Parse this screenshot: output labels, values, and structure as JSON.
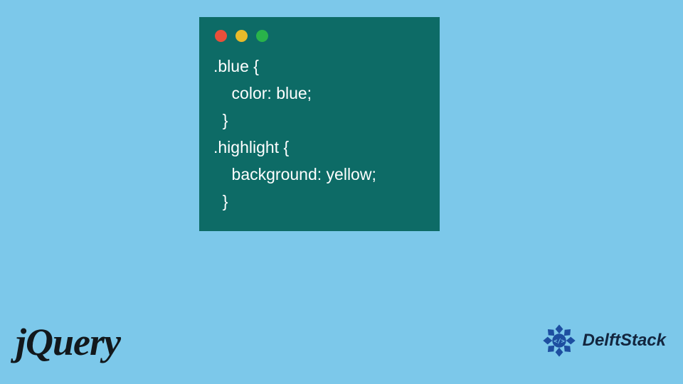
{
  "code_window": {
    "lines": [
      ".blue {",
      "    color: blue;",
      "  }",
      ".highlight {",
      "    background: yellow;",
      "  }"
    ],
    "traffic_colors": {
      "red": "#e94f3a",
      "yellow": "#e8bb2a",
      "green": "#29b34a"
    },
    "bg": "#0d6b66"
  },
  "logos": {
    "jquery": "jQuery",
    "delftstack": "DelftStack"
  },
  "page_bg": "#7cc8ea"
}
